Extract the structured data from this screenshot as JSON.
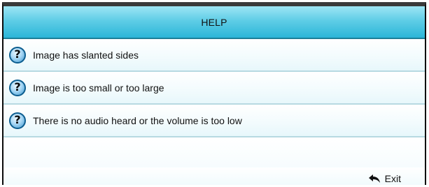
{
  "dialog": {
    "title": "HELP",
    "items": [
      {
        "label": "Image has slanted sides",
        "icon": "question-icon"
      },
      {
        "label": "Image is too small or too large",
        "icon": "question-icon"
      },
      {
        "label": "There is no audio heard or the volume is too low",
        "icon": "question-icon"
      }
    ],
    "footer": {
      "exit_label": "Exit",
      "exit_icon": "return-arrow-icon"
    },
    "colors": {
      "header_gradient_top": "#9ee6f5",
      "header_gradient_bottom": "#2bb6d8",
      "icon_blue": "#3c97cf"
    }
  }
}
